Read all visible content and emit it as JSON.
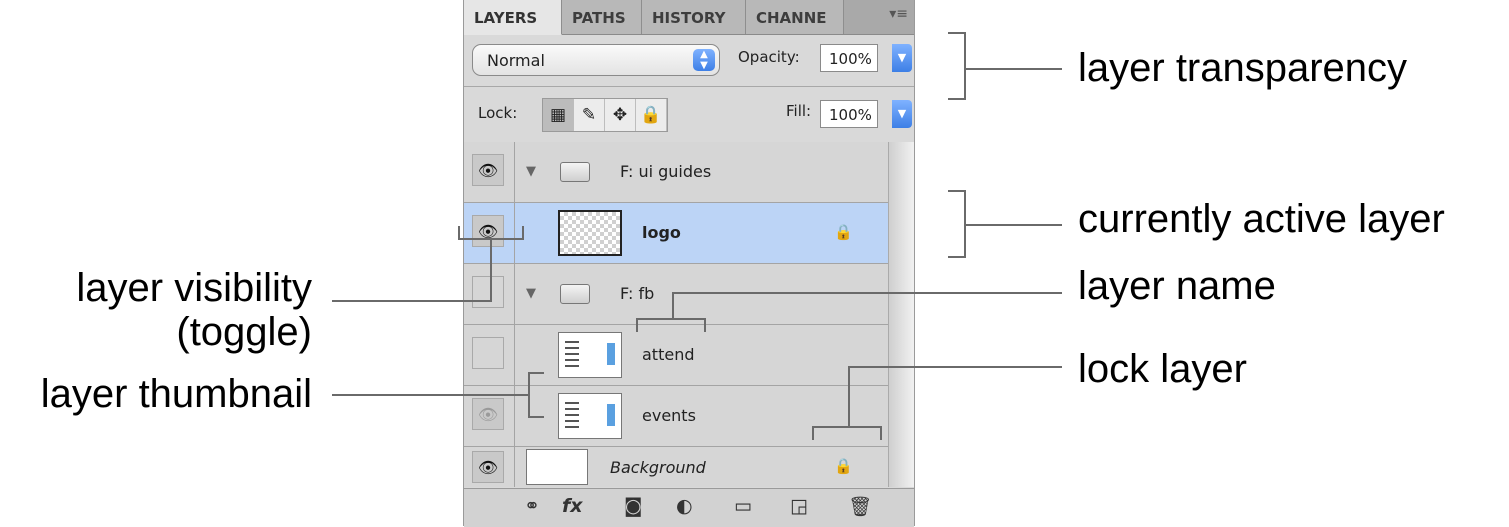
{
  "tabs": [
    "LAYERS",
    "PATHS",
    "HISTORY",
    "CHANNE"
  ],
  "tab_menu_icon": "≡",
  "blend_mode": {
    "value": "Normal",
    "arrows": "▲▼"
  },
  "opacity": {
    "label": "Opacity:",
    "value": "100%"
  },
  "lock": {
    "label": "Lock:",
    "icons": [
      "lock-transparent-icon",
      "lock-image-icon",
      "lock-position-icon",
      "lock-all-icon"
    ]
  },
  "fill": {
    "label": "Fill:",
    "value": "100%"
  },
  "layers": [
    {
      "name": "F: ui guides",
      "type": "group",
      "visible": true
    },
    {
      "name": "logo",
      "type": "layer",
      "visible": true,
      "active": true,
      "locked": true
    },
    {
      "name": "F: fb",
      "type": "group",
      "visible": false
    },
    {
      "name": "attend",
      "type": "layer",
      "visible": false
    },
    {
      "name": "events",
      "type": "layer",
      "visible": true
    },
    {
      "name": "Background",
      "type": "layer",
      "visible": true,
      "locked": true
    }
  ],
  "bottom_icons": [
    "link-icon",
    "fx-icon",
    "mask-icon",
    "adjustment-icon",
    "folder-icon",
    "new-layer-icon",
    "trash-icon"
  ],
  "glyphs": {
    "eye": "👁",
    "triangle": "▼",
    "padlock": "🔒",
    "link": "⚭",
    "fx": "fx",
    "mask": "◙",
    "adjust": "◐",
    "folder": "▭",
    "newlayer": "◲",
    "trash": "🗑",
    "move": "✥",
    "brush": "✎",
    "checker": "▦",
    "lockall": "🔒"
  },
  "annotations": {
    "transparency": "layer transparency",
    "active": "currently active layer",
    "visibility_1": "layer visibility",
    "visibility_2": "(toggle)",
    "name": "layer name",
    "thumbnail": "layer thumbnail",
    "lock": "lock layer"
  },
  "colors": {
    "active_row": "#bcd4f6",
    "accent": "#3d7fe6"
  }
}
